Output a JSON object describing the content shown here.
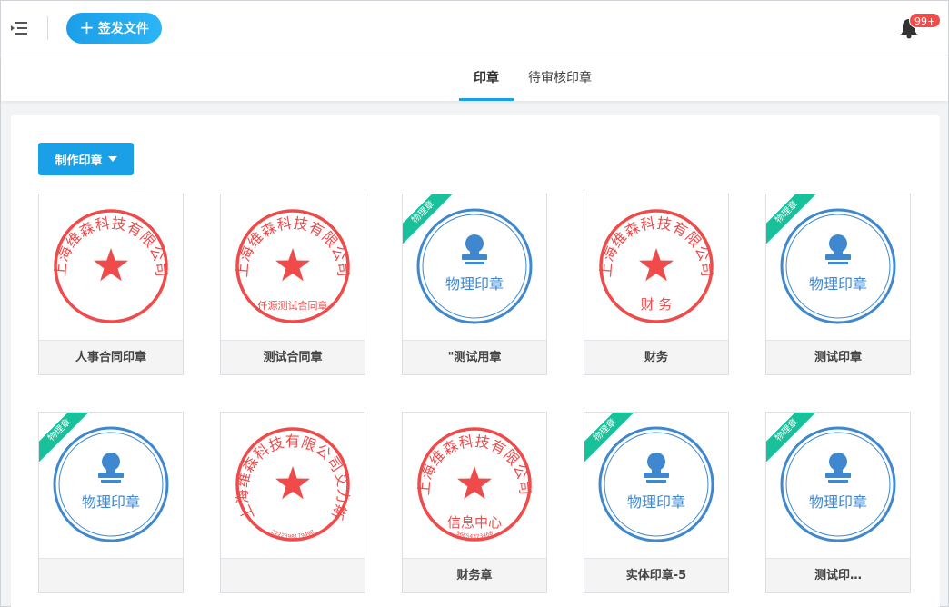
{
  "header": {
    "send_button_label": "签发文件",
    "notification_badge": "99+",
    "icons": {
      "menu": "menu-collapse-icon",
      "bell": "bell-icon",
      "plus": "plus-icon"
    }
  },
  "tabs": [
    {
      "label": "印章",
      "active": true
    },
    {
      "label": "待审核印章",
      "active": false
    }
  ],
  "toolbar": {
    "make_seal_label": "制作印章",
    "icon": "caret-down-icon"
  },
  "colors": {
    "accent": "#1aa0e6",
    "red_seal": "#ef4b4b",
    "blue_seal": "#3f88cf",
    "ribbon": "#17c29a"
  },
  "seals": [
    {
      "name": "人事合同印章",
      "type": "red",
      "arc_text": "上海维森科技有限公司",
      "bottom_text": "",
      "ribbon": ""
    },
    {
      "name": "测试合同章",
      "type": "red",
      "arc_text": "上海维森科技有限公司",
      "bottom_text": "仟源测试合同章",
      "ribbon": ""
    },
    {
      "name": "\"测试用章",
      "type": "blue",
      "center_text": "物理印章",
      "ribbon": "物理章"
    },
    {
      "name": "财务",
      "type": "red",
      "arc_text": "上海维森科技有限公司",
      "bottom_text": "财 务",
      "ribbon": ""
    },
    {
      "name": "测试印章",
      "type": "blue",
      "center_text": "物理印章",
      "ribbon": "物理章"
    },
    {
      "name": "",
      "type": "blue",
      "center_text": "物理印章",
      "ribbon": "物理章"
    },
    {
      "name": "",
      "type": "red",
      "arc_text": "上海维森科技有限公司艾力斯",
      "bottom_text": "",
      "serial": "2222398179498",
      "ribbon": ""
    },
    {
      "name": "财务章",
      "type": "red",
      "arc_text": "上海维森科技有限公司",
      "bottom_text": "信息中心",
      "serial": "36654323466",
      "ribbon": ""
    },
    {
      "name": "实体印章-5",
      "type": "blue",
      "center_text": "物理印章",
      "ribbon": "物理章"
    },
    {
      "name": "测试印…",
      "type": "blue",
      "center_text": "物理印章",
      "ribbon": "物理章"
    }
  ]
}
